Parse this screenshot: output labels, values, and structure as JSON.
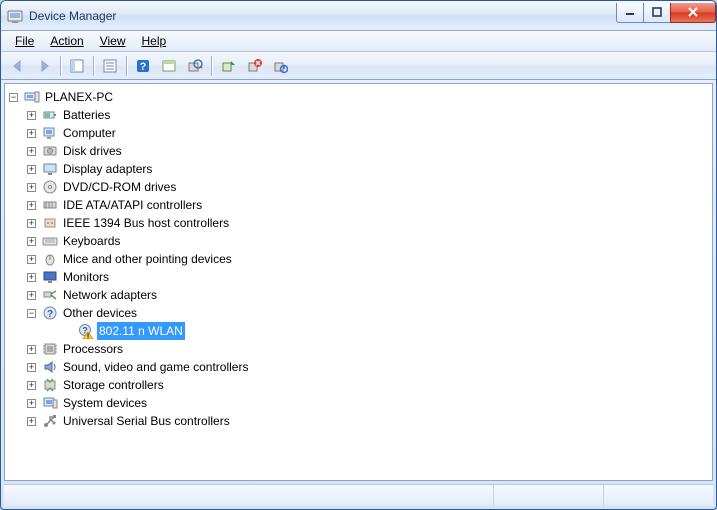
{
  "window": {
    "title": "Device Manager"
  },
  "menu": {
    "file": "File",
    "action": "Action",
    "view": "View",
    "help": "Help"
  },
  "tree": {
    "root": {
      "label": "PLANEX-PC",
      "expanded": true
    },
    "categories": [
      {
        "label": "Batteries",
        "icon": "battery"
      },
      {
        "label": "Computer",
        "icon": "computer"
      },
      {
        "label": "Disk drives",
        "icon": "disk"
      },
      {
        "label": "Display adapters",
        "icon": "display"
      },
      {
        "label": "DVD/CD-ROM drives",
        "icon": "cdrom"
      },
      {
        "label": "IDE ATA/ATAPI controllers",
        "icon": "ide"
      },
      {
        "label": "IEEE 1394 Bus host controllers",
        "icon": "1394"
      },
      {
        "label": "Keyboards",
        "icon": "keyboard"
      },
      {
        "label": "Mice and other pointing devices",
        "icon": "mouse"
      },
      {
        "label": "Monitors",
        "icon": "monitor"
      },
      {
        "label": "Network adapters",
        "icon": "network"
      },
      {
        "label": "Other devices",
        "icon": "unknown",
        "expanded": true,
        "children": [
          {
            "label": "802.11 n WLAN",
            "icon": "unknown-warn",
            "selected": true
          }
        ]
      },
      {
        "label": "Processors",
        "icon": "cpu"
      },
      {
        "label": "Sound, video and game controllers",
        "icon": "sound"
      },
      {
        "label": "Storage controllers",
        "icon": "storage"
      },
      {
        "label": "System devices",
        "icon": "system"
      },
      {
        "label": "Universal Serial Bus controllers",
        "icon": "usb"
      }
    ]
  }
}
